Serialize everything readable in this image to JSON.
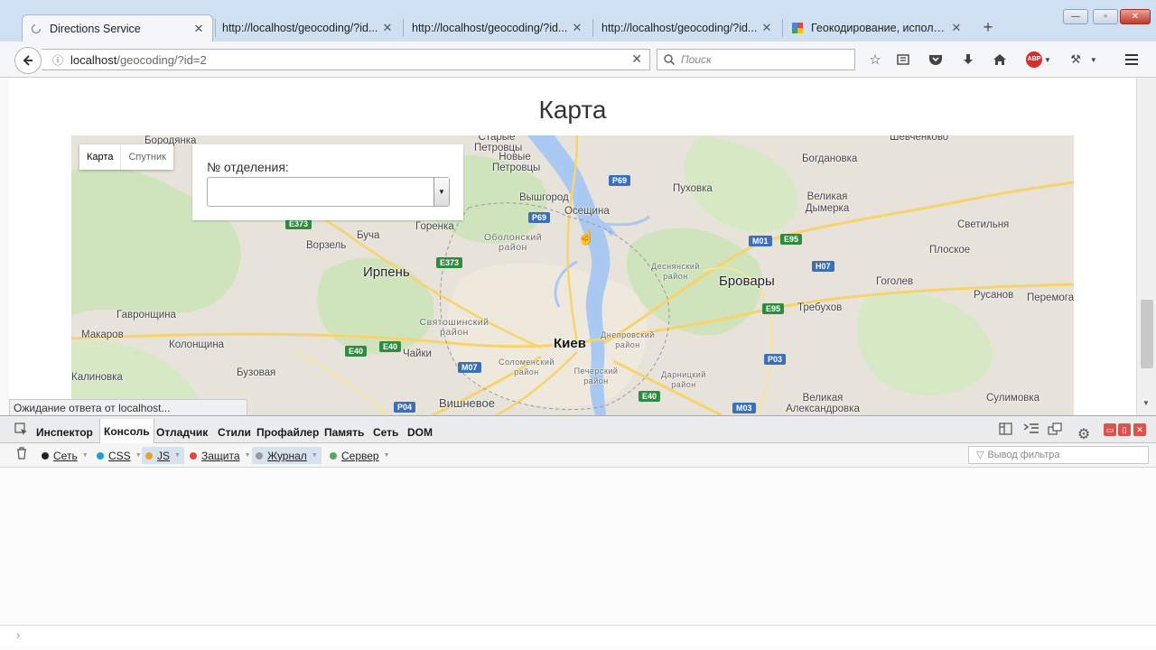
{
  "browser": {
    "tabs": [
      {
        "label": "Directions Service",
        "active": true
      },
      {
        "label": "http://localhost/geocoding/?id...",
        "active": false
      },
      {
        "label": "http://localhost/geocoding/?id...",
        "active": false
      },
      {
        "label": "http://localhost/geocoding/?id...",
        "active": false
      },
      {
        "label": "Геокодирование, использ...",
        "active": false
      }
    ],
    "new_tab_symbol": "+",
    "url_host": "localhost",
    "url_path": "/geocoding/?id=2",
    "search_placeholder": "Поиск",
    "abp_badge": "ABP",
    "status_text": "Ожидание ответа от localhost..."
  },
  "page": {
    "title": "Карта",
    "map_type": {
      "map": "Карта",
      "satellite": "Спутник"
    },
    "branch_label": "№ отделения:",
    "branch_value": ""
  },
  "map_labels": [
    "Бородянка",
    "Старые Петровцы",
    "Новые Петровцы",
    "Вышгород",
    "Осещина",
    "Пуховка",
    "Богдановка",
    "Шевченково",
    "Великая Дымерка",
    "Светильня",
    "Плоское",
    "Буча",
    "Ворзель",
    "Горенка",
    "Оболонский район",
    "Ирпень",
    "Деснянский район",
    "Бровары",
    "Гоголев",
    "Русанов",
    "Перемога",
    "Гавронщина",
    "Святошинский район",
    "Днепровский район",
    "Требухов",
    "Макаров",
    "Колонщина",
    "Киев",
    "Чайки",
    "Соломенский район",
    "Печерский район",
    "Дарницкий район",
    "Калиновка",
    "Бузовая",
    "Вишневое",
    "Великая Александровка",
    "Сулимовка"
  ],
  "road_badges": [
    "P69",
    "P69",
    "E373",
    "E373",
    "M01",
    "E95",
    "H07",
    "E95",
    "E40",
    "E40",
    "M07",
    "P03",
    "P04",
    "E40",
    "M03"
  ],
  "devtools": {
    "tabs": [
      "Инспектор",
      "Консоль",
      "Отладчик",
      "Стили",
      "Профайлер",
      "Память",
      "Сеть",
      "DOM"
    ],
    "active_tab": "Консоль",
    "filters": [
      {
        "label": "Сеть",
        "color": "#222222",
        "on": false
      },
      {
        "label": "CSS",
        "color": "#1b9fd8",
        "on": false
      },
      {
        "label": "JS",
        "color": "#e8a12e",
        "on": true
      },
      {
        "label": "Защита",
        "color": "#e64545",
        "on": false
      },
      {
        "label": "Журнал",
        "color": "#999999",
        "on": true
      },
      {
        "label": "Сервер",
        "color": "#5aa65a",
        "on": false
      }
    ],
    "filter_placeholder": "Вывод фильтра",
    "prompt_symbol": "›"
  },
  "colors": {
    "titlebar": "#cfe0f3",
    "map_land": "#e7e3da",
    "map_water": "#a9c9f2",
    "map_green": "#c7dfb4"
  }
}
